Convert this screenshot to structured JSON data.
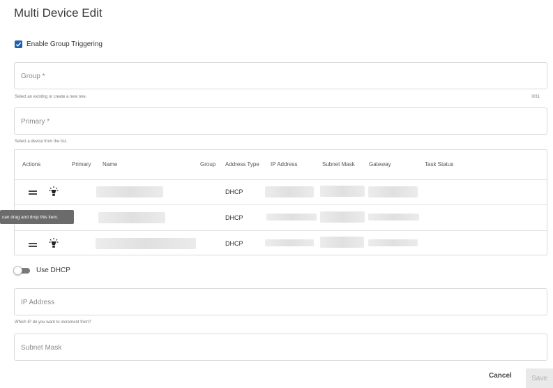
{
  "page": {
    "title": "Multi Device Edit"
  },
  "enable_group_triggering": {
    "label": "Enable Group Triggering",
    "checked": true
  },
  "group_field": {
    "placeholder": "Group *",
    "hint": "Select an existing or create a new one.",
    "counter": "0/31"
  },
  "primary_field": {
    "placeholder": "Primary *",
    "hint": "Select a device from the list."
  },
  "table": {
    "headers": {
      "actions": "Actions",
      "primary": "Primary",
      "name": "Name",
      "group": "Group",
      "address_type": "Address Type",
      "ip_address": "IP Address",
      "subnet_mask": "Subnet Mask",
      "gateway": "Gateway",
      "task_status": "Task Status"
    },
    "rows": [
      {
        "address_type": "DHCP"
      },
      {
        "address_type": "DHCP"
      },
      {
        "address_type": "DHCP"
      }
    ]
  },
  "tooltip": {
    "text": "can drag and drop this item."
  },
  "use_dhcp": {
    "label": "Use DHCP",
    "on": false
  },
  "ip_field": {
    "placeholder": "IP Address",
    "hint": "Which IP do you want to increment from?"
  },
  "subnet_field": {
    "placeholder": "Subnet Mask"
  },
  "actions": {
    "cancel": "Cancel",
    "save": "Save"
  },
  "icons": {
    "drag": "drag-handle-icon",
    "bulb": "lightbulb-icon",
    "check": "check-icon"
  }
}
